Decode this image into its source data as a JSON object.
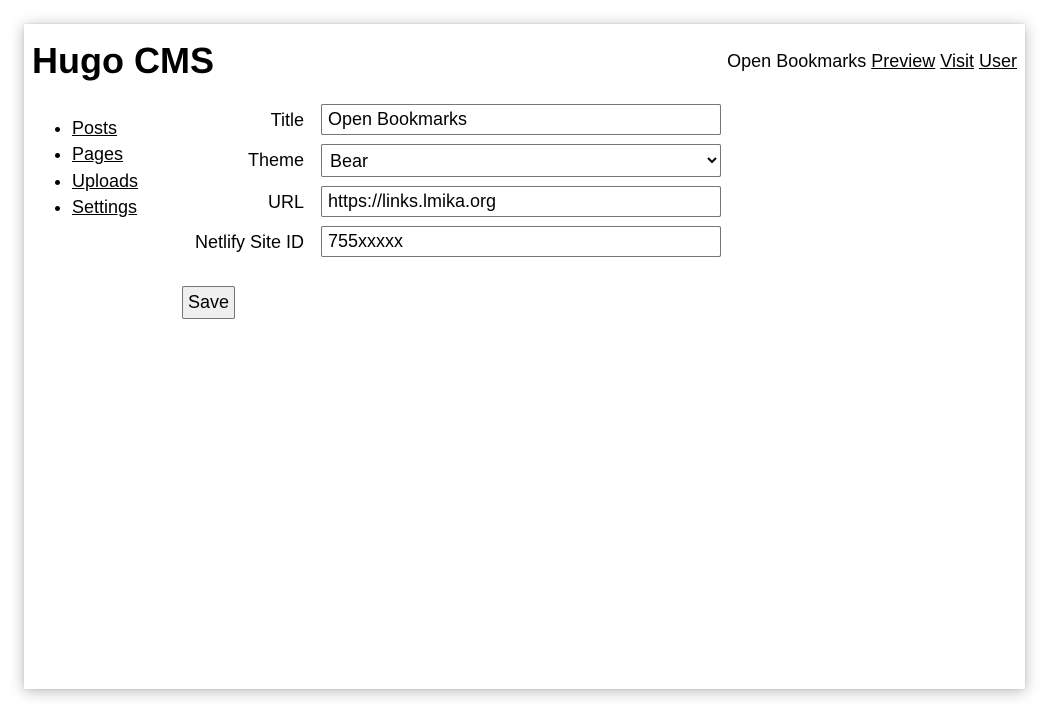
{
  "header": {
    "title": "Hugo CMS",
    "site_name": "Open Bookmarks",
    "links": [
      "Preview",
      "Visit",
      "User"
    ]
  },
  "sidebar": {
    "items": [
      {
        "label": "Posts"
      },
      {
        "label": "Pages"
      },
      {
        "label": "Uploads"
      },
      {
        "label": "Settings"
      }
    ]
  },
  "form": {
    "title": {
      "label": "Title",
      "value": "Open Bookmarks"
    },
    "theme": {
      "label": "Theme",
      "value": "Bear"
    },
    "url": {
      "label": "URL",
      "value": "https://links.lmika.org"
    },
    "netlify": {
      "label": "Netlify Site ID",
      "value": "755xxxxx"
    },
    "save_label": "Save"
  }
}
